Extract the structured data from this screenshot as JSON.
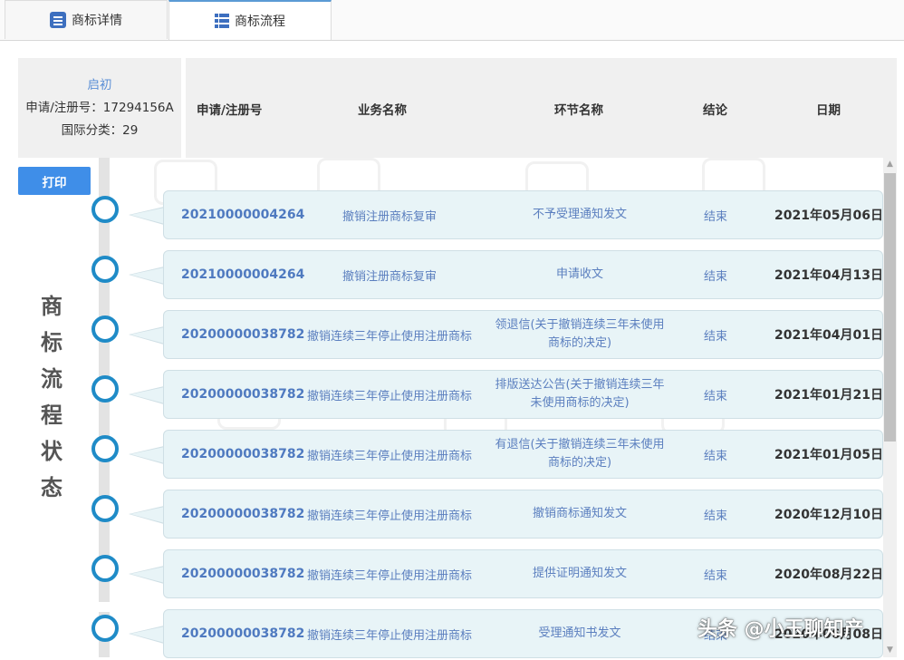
{
  "tabs": [
    {
      "label": "商标详情",
      "icon": "document-list-icon",
      "active": false
    },
    {
      "label": "商标流程",
      "icon": "flow-list-icon",
      "active": true
    }
  ],
  "info": {
    "status": "启初",
    "reg_no_line": "申请/注册号：17294156A",
    "class_line": "国际分类：29"
  },
  "columns": [
    "申请/注册号",
    "业务名称",
    "环节名称",
    "结论",
    "日期"
  ],
  "print_label": "打印",
  "side_title": [
    "商",
    "标",
    "流",
    "程",
    "状",
    "态"
  ],
  "rows": [
    {
      "no": "20210000004264",
      "biz": "撤销注册商标复审",
      "step": "不予受理通知发文",
      "result": "结束",
      "date": "2021年05月06日"
    },
    {
      "no": "20210000004264",
      "biz": "撤销注册商标复审",
      "step": "申请收文",
      "result": "结束",
      "date": "2021年04月13日"
    },
    {
      "no": "20200000038782",
      "biz": "撤销连续三年停止使用注册商标",
      "step": "领退信(关于撤销连续三年未使用商标的决定)",
      "result": "结束",
      "date": "2021年04月01日"
    },
    {
      "no": "20200000038782",
      "biz": "撤销连续三年停止使用注册商标",
      "step": "排版送达公告(关于撤销连续三年未使用商标的决定)",
      "result": "结束",
      "date": "2021年01月21日"
    },
    {
      "no": "20200000038782",
      "biz": "撤销连续三年停止使用注册商标",
      "step": "有退信(关于撤销连续三年未使用商标的决定)",
      "result": "结束",
      "date": "2021年01月05日"
    },
    {
      "no": "20200000038782",
      "biz": "撤销连续三年停止使用注册商标",
      "step": "撤销商标通知发文",
      "result": "结束",
      "date": "2020年12月10日"
    },
    {
      "no": "20200000038782",
      "biz": "撤销连续三年停止使用注册商标",
      "step": "提供证明通知发文",
      "result": "结束",
      "date": "2020年08月22日"
    },
    {
      "no": "20200000038782",
      "biz": "撤销连续三年停止使用注册商标",
      "step": "受理通知书发文",
      "result": "结束",
      "date": "2020年06月08日"
    }
  ],
  "watermark_text": "头条 @小玉聊知产",
  "colors": {
    "accent": "#3f8ee8",
    "link": "#5b7fbf",
    "card_bg": "#e8f4f7",
    "dot_ring": "#1f8bc7"
  }
}
